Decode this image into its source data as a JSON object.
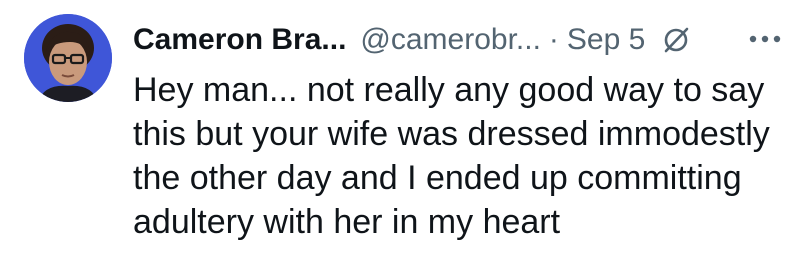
{
  "tweet": {
    "author": {
      "display_name": "Cameron Bra...",
      "handle": "@camerobr...",
      "avatar_icon": "profile-photo"
    },
    "separator": "·",
    "date": "Sep 5",
    "icons": {
      "grok": "grok-slash-circle-icon",
      "more": "more-dots-icon"
    },
    "text_lines": [
      "Hey man... not really any good way to say",
      "this but your wife was dressed immodestly",
      "the other day and I ended up committing",
      "adultery with her in my heart"
    ]
  },
  "colors": {
    "primary_text": "#0f1419",
    "secondary_text": "#536471",
    "background": "#ffffff"
  }
}
